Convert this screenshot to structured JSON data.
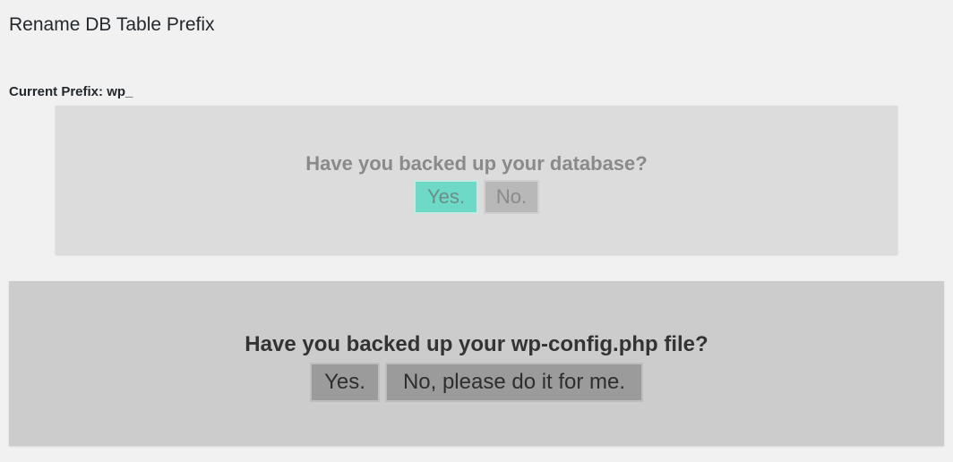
{
  "page": {
    "title": "Rename DB Table Prefix",
    "current_prefix_label": "Current Prefix: wp_"
  },
  "db_backup": {
    "question": "Have you backed up your database?",
    "yes_label": "Yes.",
    "no_label": "No.",
    "colors": {
      "panel": "#dcdcdc",
      "yes_button": "#6ed9c6",
      "no_button": "#b8b8b8"
    }
  },
  "config_backup": {
    "question": "Have you backed up your wp-config.php file?",
    "yes_label": "Yes.",
    "no_label": "No, please do it for me.",
    "colors": {
      "panel": "#cccccc",
      "buttons": "#9b9b9b"
    }
  }
}
